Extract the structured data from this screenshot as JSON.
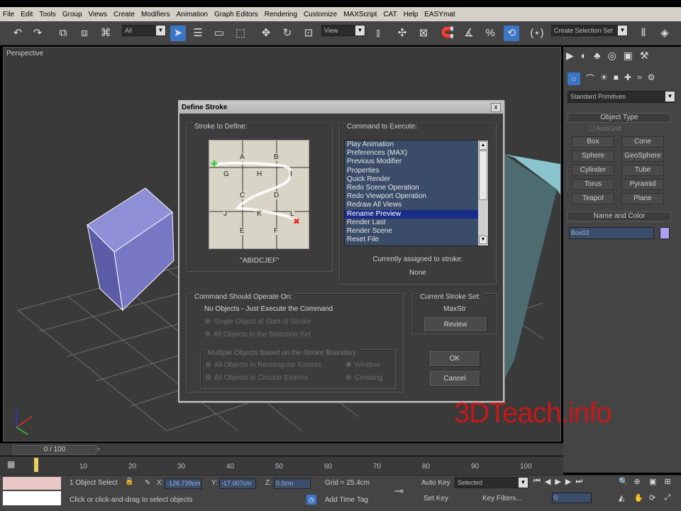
{
  "menu": [
    "File",
    "Edit",
    "Tools",
    "Group",
    "Views",
    "Create",
    "Modifiers",
    "Animation",
    "Graph Editors",
    "Rendering",
    "Customize",
    "MAXScript",
    "CAT",
    "Help",
    "EASYmat"
  ],
  "toolbar": {
    "filter_value": "All",
    "refcoord_value": "View",
    "selection_set_placeholder": "Create Selection Set",
    "icons": [
      "undo-icon",
      "redo-icon",
      "link-icon",
      "unlink-icon",
      "bind-spacewarp-icon",
      "select-object-icon",
      "select-by-name-icon",
      "rect-region-icon",
      "window-crossing-icon",
      "move-icon",
      "rotate-icon",
      "scale-icon",
      "mirror-icon",
      "align-icon",
      "snap-3d-icon",
      "angle-snap-icon",
      "percent-snap-icon",
      "spinner-snap-icon",
      "named-sets-icon",
      "mirror-tool-icon",
      "align-tool-icon"
    ]
  },
  "viewport": {
    "label": "Perspective"
  },
  "dialog": {
    "title": "Define Stroke",
    "close": "x",
    "stroke_group_label": "Stroke to Define:",
    "grid_letters": [
      "A",
      "B",
      "C",
      "D",
      "E",
      "F",
      "G",
      "H",
      "I",
      "J",
      "K",
      "L"
    ],
    "stroke_code": "\"ABIDCJEF\"",
    "command_group_label": "Command to Execute:",
    "commands": [
      "Play Animation",
      "Preferences (MAX)",
      "Previous Modifier",
      "Properties",
      "Quick Render",
      "Redo Scene Operation",
      "Redo Viewport Operation",
      "Redraw All Views",
      "Rename Preview",
      "Render Last",
      "Render Scene",
      "Reset File"
    ],
    "selected_command": "Rename Preview",
    "assigned_label": "Currently assigned to stroke:",
    "assigned_value": "None",
    "operate_group_label": "Command Should Operate On:",
    "operate_option": "No Objects - Just Execute the Command",
    "radio_single": "Single Object at Start of Stroke",
    "radio_all_sel": "All Objects in the Selection Set",
    "multi_group_label": "Multiple Objects based on the Stroke Boundary:",
    "radio_rect": "All Objects in Rectangular Extents",
    "radio_circ": "All Objects in Circular Extents",
    "radio_window": "Window",
    "radio_crossing": "Crossing",
    "current_set_label": "Current Stroke Set:",
    "current_set_value": "MaxStr",
    "review": "Review",
    "ok": "OK",
    "cancel": "Cancel"
  },
  "command_panel": {
    "dropdown": "Standard Primitives",
    "object_type": "Object Type",
    "autogrid": "AutoGrid",
    "primitives": [
      "Box",
      "Cone",
      "Sphere",
      "GeoSphere",
      "Cylinder",
      "Tube",
      "Torus",
      "Pyramid",
      "Teapot",
      "Plane"
    ],
    "name_and_color": "Name and Color",
    "object_name": "Box03",
    "object_color": "#a7a3f0"
  },
  "timeline": {
    "frame_counter": "0 / 100",
    "ticks": [
      "10",
      "20",
      "30",
      "40",
      "50",
      "60",
      "70",
      "80",
      "90",
      "100"
    ]
  },
  "status": {
    "selected": "1 Object Select",
    "prompt": "Click or click-and-drag to select objects",
    "x_label": "X:",
    "x_value": "-126.739cm",
    "y_label": "Y:",
    "y_value": "-17.007cm",
    "z_label": "Z:",
    "z_value": "0.0cm",
    "grid": "Grid = 25.4cm",
    "add_time_tag": "Add Time Tag",
    "auto_key": "Auto Key",
    "auto_key_value": "Selected",
    "set_key": "Set Key",
    "key_filters": "Key Filters...",
    "frame": "0"
  },
  "watermark": "3DTeach.info",
  "colors": {
    "accent": "#3b76c4",
    "list_selection": "#1a2c8a",
    "watermark": "#c61818"
  }
}
